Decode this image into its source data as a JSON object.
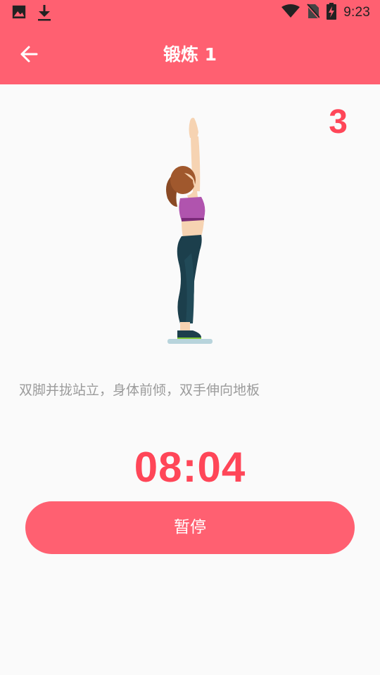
{
  "status_bar": {
    "time": "9:23",
    "left_icons": [
      "image-icon",
      "download-icon"
    ],
    "right_icons": [
      "wifi-icon",
      "no-sim-icon",
      "battery-charging-icon"
    ]
  },
  "app_bar": {
    "title": "锻炼 1",
    "back_icon": "arrow-back-icon"
  },
  "exercise": {
    "step_number": "3",
    "instruction": "双脚并拢站立，身体前倾，双手伸向地板",
    "illustration": "woman-standing-arms-raised"
  },
  "timer": {
    "value": "08:04"
  },
  "actions": {
    "pause_label": "暂停"
  },
  "colors": {
    "primary": "#ff6071",
    "accent": "#ff4658",
    "background": "#fafafa",
    "instruction_text": "#9b9b9b"
  }
}
